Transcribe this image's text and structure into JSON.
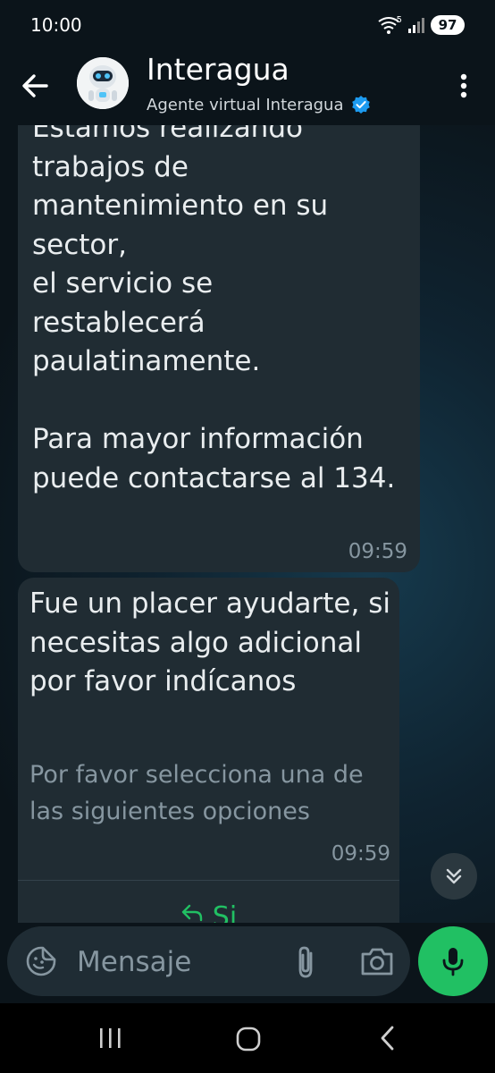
{
  "status_bar": {
    "time": "10:00",
    "network_label": "5",
    "battery": "97"
  },
  "header": {
    "contact_name": "Interagua",
    "subtitle": "Agente virtual Interagua"
  },
  "messages": [
    {
      "text": "Estamos realizando\ntrabajos de\nmantenimiento en su\nsector,\nel servicio se\nrestablecerá\npaulatinamente.\n\nPara mayor información\npuede contactarse al 134.",
      "time": "09:59"
    },
    {
      "text": "Fue un placer ayudarte, si necesitas algo adicional por favor indícanos",
      "footer": "Por favor selecciona una de las siguientes opciones",
      "time": "09:59",
      "reply_buttons": [
        {
          "label": "Si"
        }
      ]
    }
  ],
  "composer": {
    "placeholder": "Mensaje"
  },
  "icons": {
    "back": "arrow-back-icon",
    "verified": "verified-badge-icon",
    "menu": "more-vert-icon",
    "reply": "reply-icon",
    "scroll_down": "chevron-double-down-icon",
    "emoji": "sticker-icon",
    "attach": "paperclip-icon",
    "camera": "camera-icon",
    "mic": "microphone-icon"
  },
  "colors": {
    "background": "#0b141a",
    "bubble": "#202c33",
    "accent_green": "#21c063",
    "verified_blue": "#1d9bf0",
    "secondary_text": "#8696a0"
  }
}
